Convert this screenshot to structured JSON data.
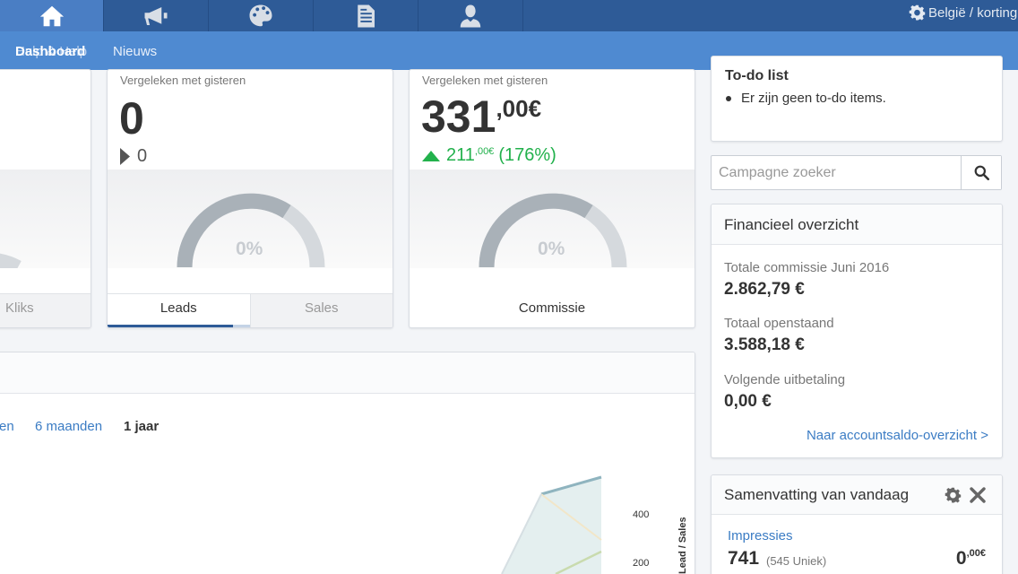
{
  "nav": {
    "tabs": [
      {
        "icon": "home-icon"
      },
      {
        "icon": "megaphone-icon"
      },
      {
        "icon": "palette-icon"
      },
      {
        "icon": "document-icon"
      },
      {
        "icon": "user-icon"
      }
    ],
    "locale_label": "België / korting"
  },
  "subnav": {
    "active": "Dashboard",
    "behind": "Hulp & Help",
    "news": "Nieuws"
  },
  "cards": {
    "clicks": {
      "tab_label": "Kliks"
    },
    "leads": {
      "compare_label": "Vergeleken met gisteren",
      "value": "0",
      "delta": "0",
      "gauge_pct": "0%",
      "tabs": [
        "Leads",
        "Sales"
      ]
    },
    "commission": {
      "compare_label": "Vergeleken met gisteren",
      "value_main": "331",
      "value_cents": ",00€",
      "delta_main": "211",
      "delta_cents": ",00€",
      "delta_pct": "(176%)",
      "gauge_pct": "0%",
      "label": "Commissie"
    }
  },
  "todo": {
    "title": "To-do list",
    "empty_text": "Er zijn geen to-do items."
  },
  "search": {
    "placeholder": "Campagne zoeker"
  },
  "finance": {
    "title": "Financieel overzicht",
    "rows": [
      {
        "label": "Totale commissie Juni 2016",
        "value": "2.862,79 €"
      },
      {
        "label": "Totaal openstaand",
        "value": "3.588,18 €"
      },
      {
        "label": "Volgende uitbetaling",
        "value": "0,00 €"
      }
    ],
    "link": "Naar accountsaldo-overzicht >"
  },
  "summary": {
    "title": "Samenvatting van vandaag",
    "impressions_label": "Impressies",
    "impressions_value": "741",
    "impressions_unique": "(545 Uniek)",
    "amount_main": "0",
    "amount_cents": ",00€"
  },
  "chart": {
    "period_options": [
      "en",
      "6 maanden",
      "1 jaar"
    ],
    "selected_period": "1 jaar",
    "y_ticks": [
      "400",
      "200"
    ],
    "y_axis_label": "Lead / Sales"
  },
  "colors": {
    "topbar": "#2e5b97",
    "subbar": "#4f8ad1",
    "positive": "#22b14c",
    "link": "#3b7cc4"
  }
}
